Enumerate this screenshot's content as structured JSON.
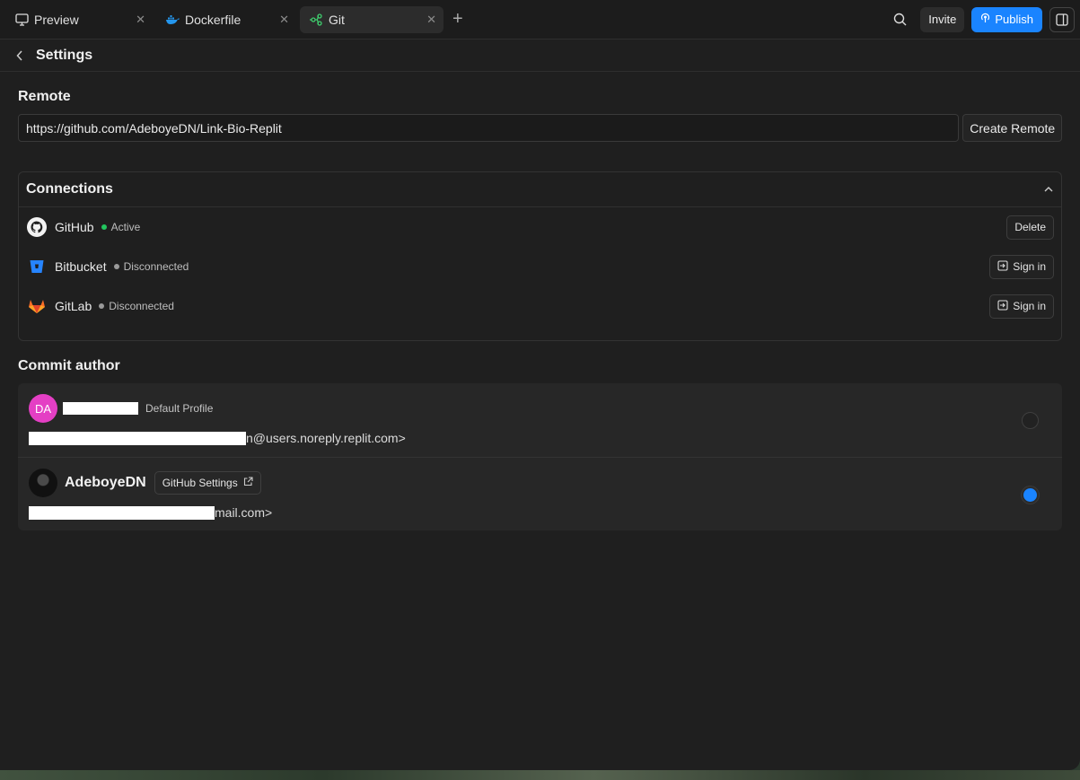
{
  "tabs": [
    {
      "label": "Preview",
      "icon": "monitor-icon"
    },
    {
      "label": "Dockerfile",
      "icon": "docker-icon"
    },
    {
      "label": "Git",
      "icon": "git-branch-icon"
    }
  ],
  "topbar": {
    "invite_label": "Invite",
    "publish_label": "Publish"
  },
  "header": {
    "title": "Settings"
  },
  "remote": {
    "title": "Remote",
    "url": "https://github.com/AdeboyeDN/Link-Bio-Replit",
    "create_label": "Create Remote"
  },
  "connections": {
    "title": "Connections",
    "items": [
      {
        "name": "GitHub",
        "status": "Active",
        "status_color": "#22c55e",
        "action": "Delete"
      },
      {
        "name": "Bitbucket",
        "status": "Disconnected",
        "status_color": "#9a9a9a",
        "action": "Sign in"
      },
      {
        "name": "GitLab",
        "status": "Disconnected",
        "status_color": "#9a9a9a",
        "action": "Sign in"
      }
    ]
  },
  "commit_author": {
    "title": "Commit author",
    "authors": [
      {
        "initials": "DA",
        "tag": "Default Profile",
        "email_suffix": "n@users.noreply.replit.com>",
        "selected": false
      },
      {
        "name": "AdeboyeDN",
        "settings_label": "GitHub Settings",
        "email_suffix": "mail.com>",
        "selected": true
      }
    ]
  },
  "colors": {
    "accent": "#1a84ff",
    "avatar_pink": "#e43fc4"
  }
}
